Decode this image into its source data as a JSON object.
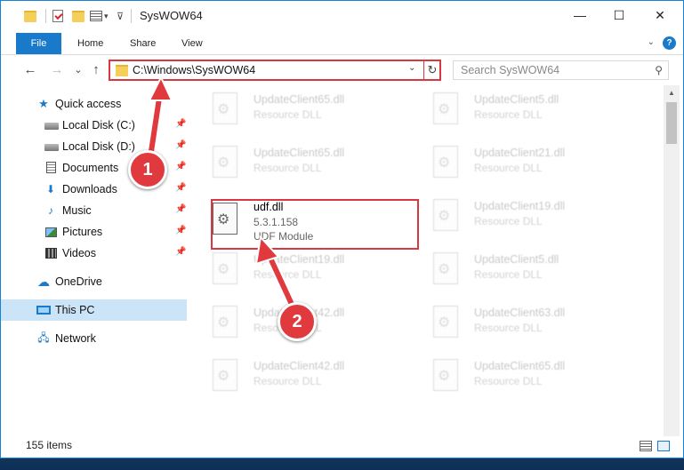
{
  "window": {
    "title": "SysWOW64",
    "minimize": "—",
    "maximize": "☐",
    "close": "✕"
  },
  "ribbon": {
    "tabs": [
      "File",
      "Home",
      "Share",
      "View"
    ],
    "help": "?"
  },
  "address": {
    "path": "C:\\Windows\\SysWOW64",
    "back": "←",
    "forward": "→",
    "recent": "⌄",
    "up": "↑",
    "refresh": "↻",
    "dropdown": "⌄"
  },
  "search": {
    "placeholder": "Search SysWOW64",
    "icon": "⚲"
  },
  "nav": [
    {
      "label": "Quick access",
      "icon": "star-icon"
    },
    {
      "label": "Local Disk (C:)",
      "icon": "drive-icon",
      "pinned": true
    },
    {
      "label": "Local Disk (D:)",
      "icon": "drive-icon",
      "pinned": true
    },
    {
      "label": "Documents",
      "icon": "document-icon",
      "pinned": true
    },
    {
      "label": "Downloads",
      "icon": "download-icon",
      "pinned": true
    },
    {
      "label": "Music",
      "icon": "music-icon",
      "pinned": true
    },
    {
      "label": "Pictures",
      "icon": "pictures-icon",
      "pinned": true
    },
    {
      "label": "Videos",
      "icon": "videos-icon",
      "pinned": true
    },
    {
      "label": "OneDrive",
      "icon": "cloud-icon"
    },
    {
      "label": "This PC",
      "icon": "computer-icon",
      "selected": true
    },
    {
      "label": "Network",
      "icon": "network-icon"
    }
  ],
  "files": [
    {
      "name": "UpdateClient65.dll",
      "desc": "Resource DLL"
    },
    {
      "name": "UpdateClient5.dll",
      "desc": "Resource DLL"
    },
    {
      "name": "UpdateClient65.dll",
      "desc": "Resource DLL"
    },
    {
      "name": "UpdateClient21.dll",
      "desc": "Resource DLL"
    },
    {
      "name": "udf.dll",
      "desc": "5.3.1.158",
      "desc2": "UDF Module",
      "highlight": true
    },
    {
      "name": "UpdateClient19.dll",
      "desc": "Resource DLL"
    },
    {
      "name": "UpdateClient19.dll",
      "desc": "Resource DLL"
    },
    {
      "name": "UpdateClient5.dll",
      "desc": "Resource DLL"
    },
    {
      "name": "UpdateClient42.dll",
      "desc": "Resource DLL"
    },
    {
      "name": "UpdateClient63.dll",
      "desc": "Resource DLL"
    },
    {
      "name": "UpdateClient42.dll",
      "desc": "Resource DLL"
    },
    {
      "name": "UpdateClient65.dll",
      "desc": "Resource DLL"
    }
  ],
  "status": {
    "count": "155 items"
  },
  "annotations": {
    "step1": "1",
    "step2": "2",
    "color": "#e0393e"
  }
}
